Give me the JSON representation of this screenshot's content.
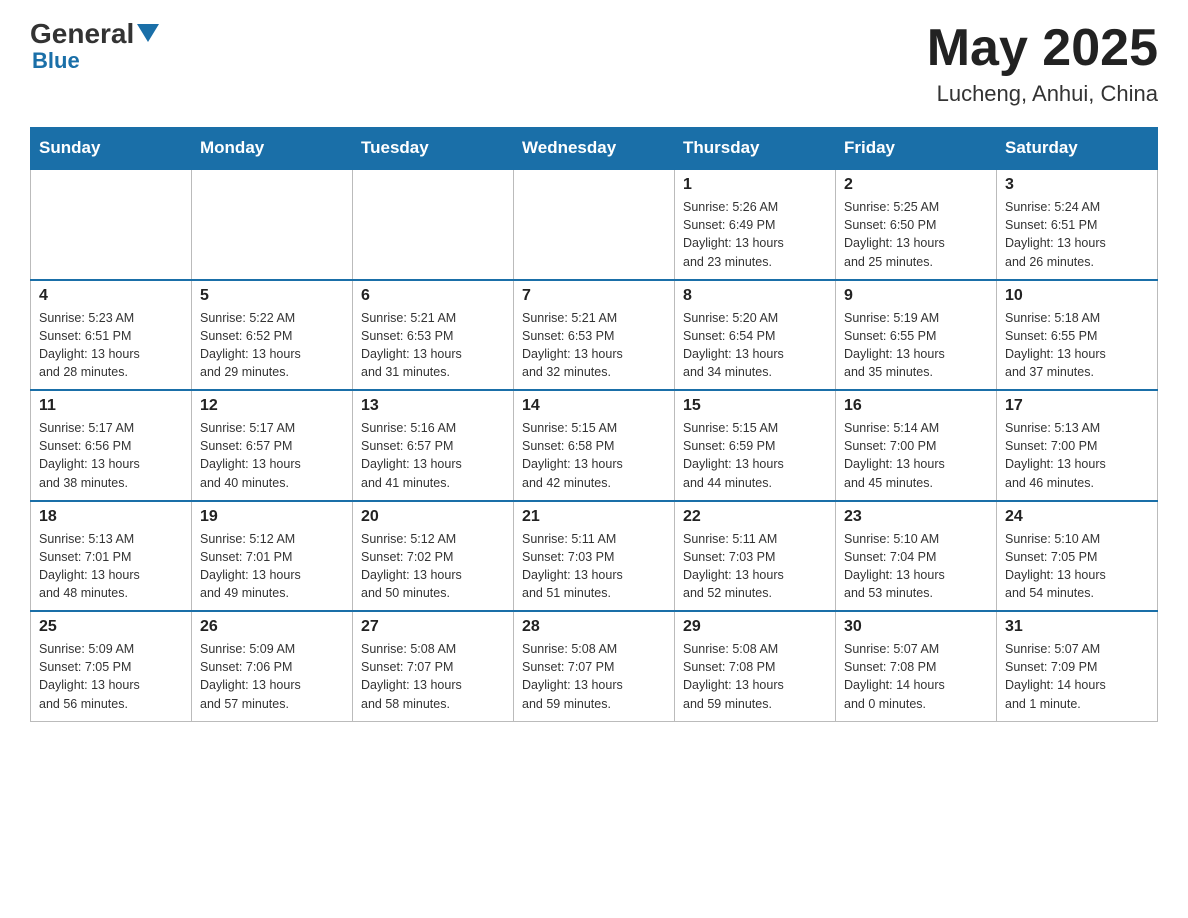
{
  "header": {
    "logo_general": "General",
    "logo_blue": "Blue",
    "month_year": "May 2025",
    "location": "Lucheng, Anhui, China"
  },
  "days_of_week": [
    "Sunday",
    "Monday",
    "Tuesday",
    "Wednesday",
    "Thursday",
    "Friday",
    "Saturday"
  ],
  "weeks": [
    [
      {
        "day": "",
        "info": ""
      },
      {
        "day": "",
        "info": ""
      },
      {
        "day": "",
        "info": ""
      },
      {
        "day": "",
        "info": ""
      },
      {
        "day": "1",
        "info": "Sunrise: 5:26 AM\nSunset: 6:49 PM\nDaylight: 13 hours\nand 23 minutes."
      },
      {
        "day": "2",
        "info": "Sunrise: 5:25 AM\nSunset: 6:50 PM\nDaylight: 13 hours\nand 25 minutes."
      },
      {
        "day": "3",
        "info": "Sunrise: 5:24 AM\nSunset: 6:51 PM\nDaylight: 13 hours\nand 26 minutes."
      }
    ],
    [
      {
        "day": "4",
        "info": "Sunrise: 5:23 AM\nSunset: 6:51 PM\nDaylight: 13 hours\nand 28 minutes."
      },
      {
        "day": "5",
        "info": "Sunrise: 5:22 AM\nSunset: 6:52 PM\nDaylight: 13 hours\nand 29 minutes."
      },
      {
        "day": "6",
        "info": "Sunrise: 5:21 AM\nSunset: 6:53 PM\nDaylight: 13 hours\nand 31 minutes."
      },
      {
        "day": "7",
        "info": "Sunrise: 5:21 AM\nSunset: 6:53 PM\nDaylight: 13 hours\nand 32 minutes."
      },
      {
        "day": "8",
        "info": "Sunrise: 5:20 AM\nSunset: 6:54 PM\nDaylight: 13 hours\nand 34 minutes."
      },
      {
        "day": "9",
        "info": "Sunrise: 5:19 AM\nSunset: 6:55 PM\nDaylight: 13 hours\nand 35 minutes."
      },
      {
        "day": "10",
        "info": "Sunrise: 5:18 AM\nSunset: 6:55 PM\nDaylight: 13 hours\nand 37 minutes."
      }
    ],
    [
      {
        "day": "11",
        "info": "Sunrise: 5:17 AM\nSunset: 6:56 PM\nDaylight: 13 hours\nand 38 minutes."
      },
      {
        "day": "12",
        "info": "Sunrise: 5:17 AM\nSunset: 6:57 PM\nDaylight: 13 hours\nand 40 minutes."
      },
      {
        "day": "13",
        "info": "Sunrise: 5:16 AM\nSunset: 6:57 PM\nDaylight: 13 hours\nand 41 minutes."
      },
      {
        "day": "14",
        "info": "Sunrise: 5:15 AM\nSunset: 6:58 PM\nDaylight: 13 hours\nand 42 minutes."
      },
      {
        "day": "15",
        "info": "Sunrise: 5:15 AM\nSunset: 6:59 PM\nDaylight: 13 hours\nand 44 minutes."
      },
      {
        "day": "16",
        "info": "Sunrise: 5:14 AM\nSunset: 7:00 PM\nDaylight: 13 hours\nand 45 minutes."
      },
      {
        "day": "17",
        "info": "Sunrise: 5:13 AM\nSunset: 7:00 PM\nDaylight: 13 hours\nand 46 minutes."
      }
    ],
    [
      {
        "day": "18",
        "info": "Sunrise: 5:13 AM\nSunset: 7:01 PM\nDaylight: 13 hours\nand 48 minutes."
      },
      {
        "day": "19",
        "info": "Sunrise: 5:12 AM\nSunset: 7:01 PM\nDaylight: 13 hours\nand 49 minutes."
      },
      {
        "day": "20",
        "info": "Sunrise: 5:12 AM\nSunset: 7:02 PM\nDaylight: 13 hours\nand 50 minutes."
      },
      {
        "day": "21",
        "info": "Sunrise: 5:11 AM\nSunset: 7:03 PM\nDaylight: 13 hours\nand 51 minutes."
      },
      {
        "day": "22",
        "info": "Sunrise: 5:11 AM\nSunset: 7:03 PM\nDaylight: 13 hours\nand 52 minutes."
      },
      {
        "day": "23",
        "info": "Sunrise: 5:10 AM\nSunset: 7:04 PM\nDaylight: 13 hours\nand 53 minutes."
      },
      {
        "day": "24",
        "info": "Sunrise: 5:10 AM\nSunset: 7:05 PM\nDaylight: 13 hours\nand 54 minutes."
      }
    ],
    [
      {
        "day": "25",
        "info": "Sunrise: 5:09 AM\nSunset: 7:05 PM\nDaylight: 13 hours\nand 56 minutes."
      },
      {
        "day": "26",
        "info": "Sunrise: 5:09 AM\nSunset: 7:06 PM\nDaylight: 13 hours\nand 57 minutes."
      },
      {
        "day": "27",
        "info": "Sunrise: 5:08 AM\nSunset: 7:07 PM\nDaylight: 13 hours\nand 58 minutes."
      },
      {
        "day": "28",
        "info": "Sunrise: 5:08 AM\nSunset: 7:07 PM\nDaylight: 13 hours\nand 59 minutes."
      },
      {
        "day": "29",
        "info": "Sunrise: 5:08 AM\nSunset: 7:08 PM\nDaylight: 13 hours\nand 59 minutes."
      },
      {
        "day": "30",
        "info": "Sunrise: 5:07 AM\nSunset: 7:08 PM\nDaylight: 14 hours\nand 0 minutes."
      },
      {
        "day": "31",
        "info": "Sunrise: 5:07 AM\nSunset: 7:09 PM\nDaylight: 14 hours\nand 1 minute."
      }
    ]
  ]
}
